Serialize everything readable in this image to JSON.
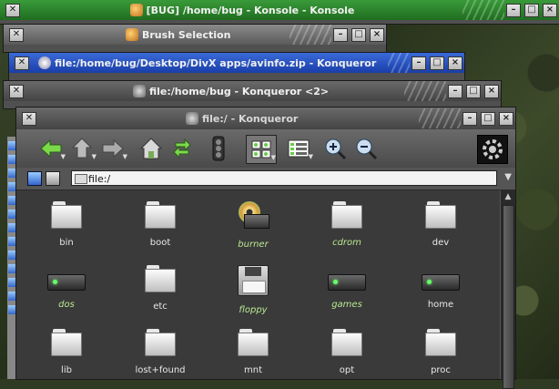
{
  "windows": {
    "konsole": {
      "title": "[BUG] /home/bug - Konsole - Konsole"
    },
    "brush": {
      "title": "Brush Selection"
    },
    "avinfo": {
      "title": "file:/home/bug/Desktop/DivX apps/avinfo.zip - Konqueror"
    },
    "konq2": {
      "title": "file:/home/bug - Konqueror <2>"
    },
    "main": {
      "title": "file:/ - Konqueror"
    }
  },
  "window_buttons": {
    "minimize": "–",
    "maximize": "□",
    "close": "×",
    "close_x": "✕"
  },
  "location": {
    "value": "file:/"
  },
  "files": [
    {
      "name": "bin",
      "kind": "folder",
      "style": "normal"
    },
    {
      "name": "boot",
      "kind": "folder",
      "style": "normal"
    },
    {
      "name": "burner",
      "kind": "burner",
      "style": "link"
    },
    {
      "name": "cdrom",
      "kind": "folder",
      "style": "link"
    },
    {
      "name": "dev",
      "kind": "folder",
      "style": "normal"
    },
    {
      "name": "dos",
      "kind": "drive",
      "style": "link"
    },
    {
      "name": "etc",
      "kind": "folder",
      "style": "normal"
    },
    {
      "name": "floppy",
      "kind": "floppy",
      "style": "link"
    },
    {
      "name": "games",
      "kind": "drive",
      "style": "link"
    },
    {
      "name": "home",
      "kind": "drive",
      "style": "normal"
    },
    {
      "name": "lib",
      "kind": "folder",
      "style": "normal"
    },
    {
      "name": "lost+found",
      "kind": "folder",
      "style": "normal"
    },
    {
      "name": "mnt",
      "kind": "folder",
      "style": "normal"
    },
    {
      "name": "opt",
      "kind": "folder",
      "style": "normal"
    },
    {
      "name": "proc",
      "kind": "folder",
      "style": "normal"
    }
  ],
  "colors": {
    "link_label": "#b8e890",
    "normal_label": "#e8e8e8"
  }
}
